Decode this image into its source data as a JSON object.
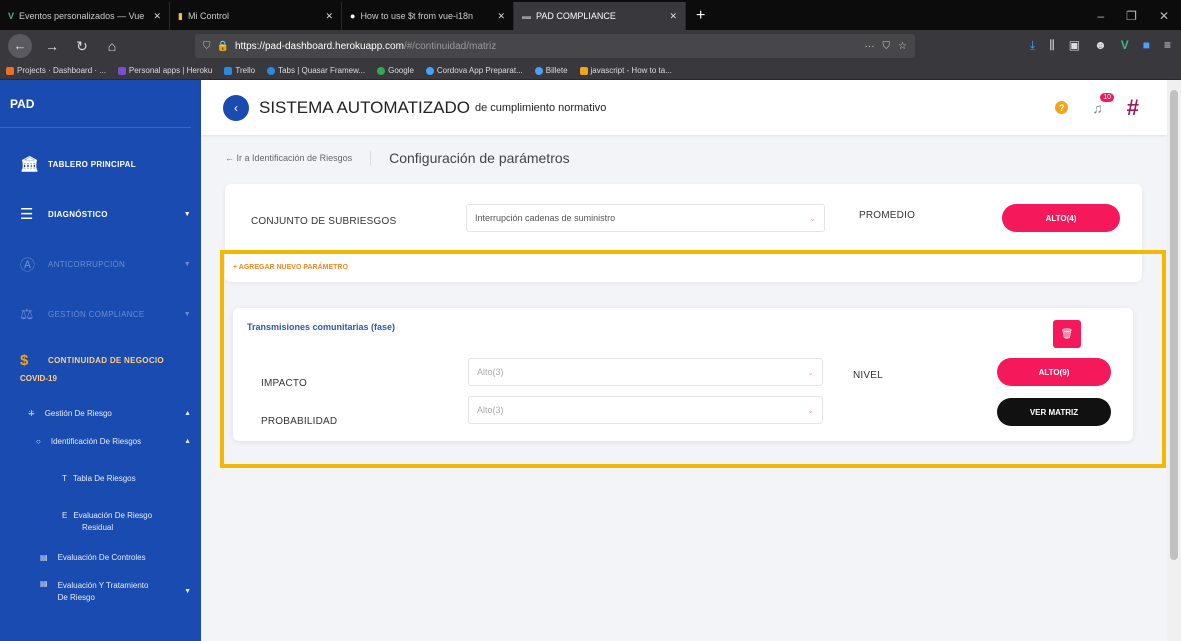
{
  "browser": {
    "tabs": [
      {
        "label": "Eventos personalizados — Vue",
        "icon": "vue-icon",
        "active": false
      },
      {
        "label": "Mi Control",
        "icon": "page-icon",
        "active": false
      },
      {
        "label": "How to use $t from vue-i18n",
        "icon": "page-icon",
        "active": false
      },
      {
        "label": "PAD COMPLIANCE",
        "icon": "page-icon",
        "active": true
      }
    ],
    "url_host": "https://pad-dashboard.herokuapp.com",
    "url_path": "/#/continuidad/matriz",
    "bookmarks": [
      "Projects · Dashboard · ...",
      "Personal apps | Heroku",
      "Trello",
      "Tabs | Quasar Framew...",
      "Google",
      "Cordova App Preparat...",
      "Billete",
      "javascript - How to ta..."
    ]
  },
  "sidebar": {
    "brand": "PAD",
    "items": [
      {
        "label": "TABLERO PRINCIPAL",
        "icon": "bank-icon"
      },
      {
        "label": "DIAGNÓSTICO",
        "icon": "list-icon"
      },
      {
        "label": "ANTICORRUPCIÓN",
        "icon": "shield-icon"
      },
      {
        "label": "GESTIÓN COMPLIANCE",
        "icon": "scale-icon"
      },
      {
        "label": "CONTINUIDAD DE NEGOCIO",
        "label2": "COVID-19",
        "icon": "continuity-icon"
      }
    ],
    "sub": {
      "gestion": "Gestión De Riesgo",
      "identificacion": "Identificación De Riesgos",
      "tabla": "Tabla De Riesgos",
      "evaluacion_residual_1": "Evaluación De Riesgo",
      "evaluacion_residual_2": "Residual",
      "controles": "Evaluación De Controles",
      "tratamiento_1": "Evaluación Y Tratamiento",
      "tratamiento_2": "De Riesgo"
    }
  },
  "header": {
    "title": "SISTEMA AUTOMATIZADO",
    "subtitle": "de cumplimiento normativo",
    "notification_count": "10"
  },
  "breadcrumb": {
    "back": "Ir a Identificación de Riesgos",
    "current": "Configuración de parámetros"
  },
  "config": {
    "subset_label": "CONJUNTO DE SUBRIESGOS",
    "subset_value": "Interrupción cadenas de suministro",
    "average_label": "PROMEDIO",
    "average_value": "ALTO(4)",
    "add_param": "+ AGREGAR NUEVO PARÁMETRO"
  },
  "parameter": {
    "title": "Transmisiones comunitarias (fase)",
    "impact_label": "IMPACTO",
    "impact_placeholder": "Alto(3)",
    "prob_label": "PROBABILIDAD",
    "prob_placeholder": "Alto(3)",
    "level_label": "NIVEL",
    "level_value": "ALTO(9)",
    "matrix_button": "VER MATRIZ"
  },
  "colors": {
    "sidebar": "#1a4bb0",
    "accent": "#f5195c",
    "highlight": "#f5b800"
  }
}
